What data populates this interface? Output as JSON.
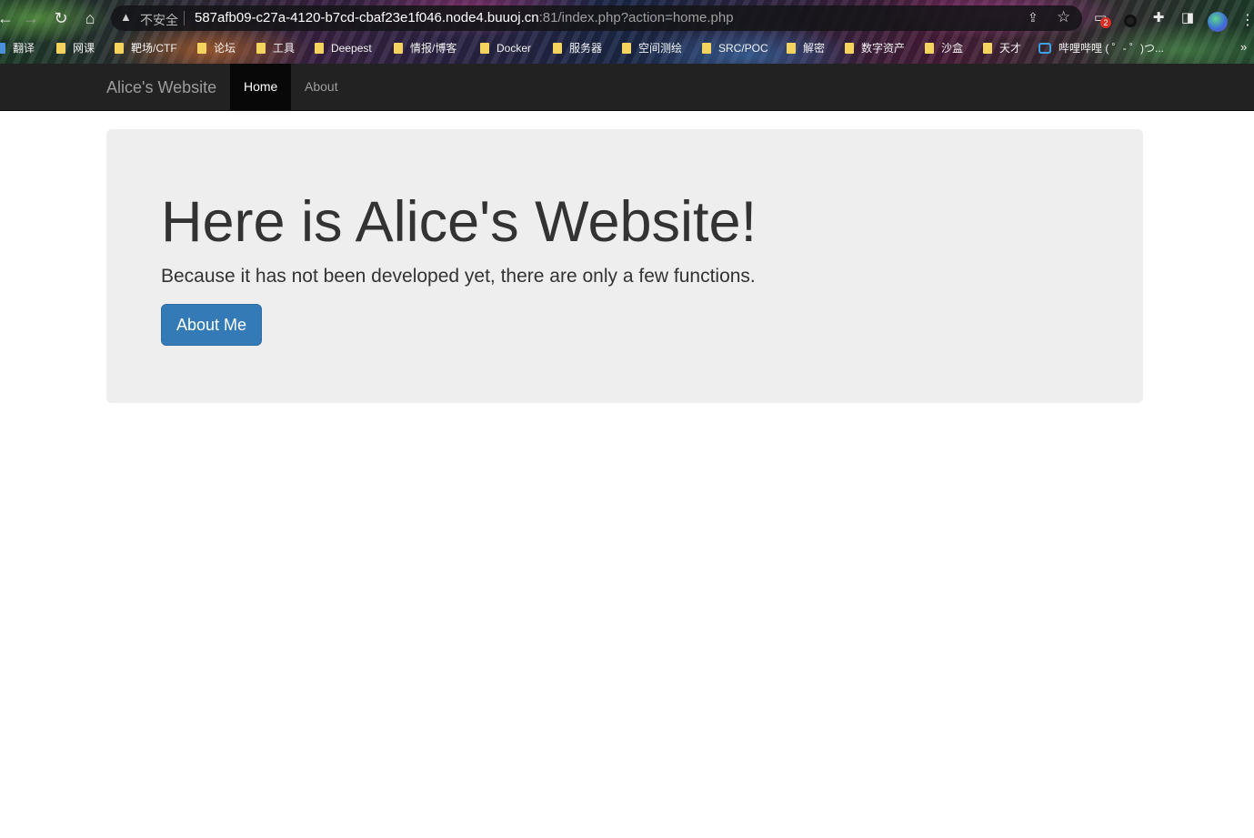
{
  "browser": {
    "security_label": "不安全",
    "url_host": "587afb09-c27a-4120-b7cd-cbaf23e1f046.node4.buuoj.cn",
    "url_rest": ":81/index.php?action=home.php",
    "extension_badge": "2",
    "bookmarks": [
      {
        "label": "翻译",
        "icon": "translate-icon"
      },
      {
        "label": "网课",
        "icon": "folder-icon"
      },
      {
        "label": "靶场/CTF",
        "icon": "folder-icon"
      },
      {
        "label": "论坛",
        "icon": "folder-icon"
      },
      {
        "label": "工具",
        "icon": "folder-icon"
      },
      {
        "label": "Deepest",
        "icon": "folder-icon"
      },
      {
        "label": "情报/博客",
        "icon": "folder-icon"
      },
      {
        "label": "Docker",
        "icon": "folder-icon"
      },
      {
        "label": "服务器",
        "icon": "folder-icon"
      },
      {
        "label": "空间测绘",
        "icon": "folder-icon"
      },
      {
        "label": "SRC/POC",
        "icon": "folder-icon"
      },
      {
        "label": "解密",
        "icon": "folder-icon"
      },
      {
        "label": "数字资产",
        "icon": "folder-icon"
      },
      {
        "label": "沙盒",
        "icon": "folder-icon"
      },
      {
        "label": "天才",
        "icon": "folder-icon"
      },
      {
        "label": "哔哩哔哩 ( ゜- ゜)つ...",
        "icon": "bilibili-icon"
      }
    ],
    "bookmark_more": "»"
  },
  "navbar": {
    "brand": "Alice's Website",
    "items": [
      {
        "label": "Home",
        "active": true
      },
      {
        "label": "About",
        "active": false
      }
    ]
  },
  "jumbotron": {
    "heading": "Here is Alice's Website!",
    "lead": "Because it has not been developed yet, there are only a few functions.",
    "button_label": "About Me"
  },
  "colors": {
    "navbar_bg": "#222222",
    "nav_active_bg": "#080808",
    "jumbotron_bg": "#eeeeee",
    "primary_button": "#337ab7"
  }
}
